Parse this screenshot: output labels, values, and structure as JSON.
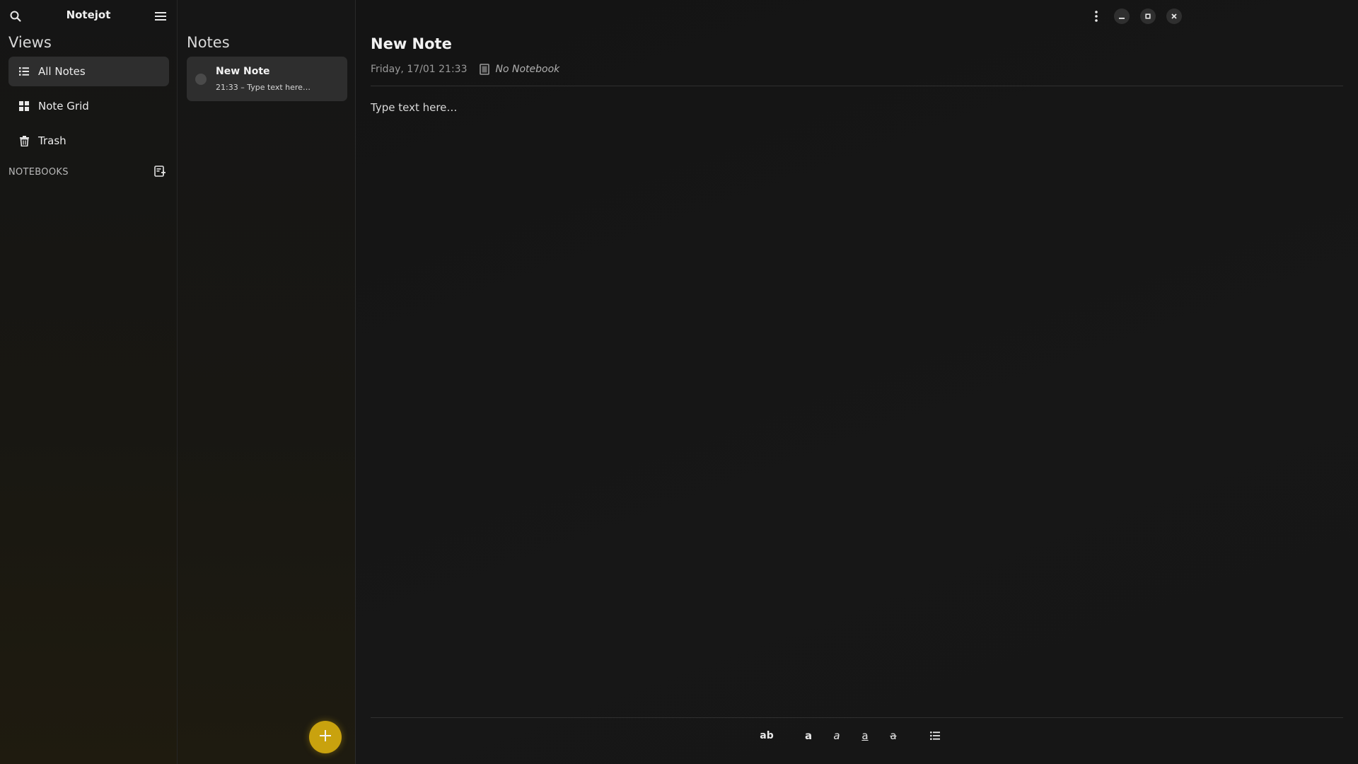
{
  "sidebar": {
    "title": "Notejot",
    "views_heading": "Views",
    "items": [
      {
        "label": "All Notes",
        "icon": "list-icon",
        "active": true
      },
      {
        "label": "Note Grid",
        "icon": "grid-icon",
        "active": false
      },
      {
        "label": "Trash",
        "icon": "trash-icon",
        "active": false
      }
    ],
    "notebooks_label": "NOTEBOOKS"
  },
  "notes_list": {
    "heading": "Notes",
    "notes": [
      {
        "title": "New Note",
        "subtitle": "21:33 – Type text here…"
      }
    ]
  },
  "editor": {
    "title": "New Note",
    "date": "Friday, 17/01 21:33",
    "notebook": "No Notebook",
    "body": "Type text here…",
    "format_buttons": [
      {
        "icon": "normal-text-icon",
        "glyph": "ab"
      },
      {
        "icon": "bold-icon",
        "glyph": "a"
      },
      {
        "icon": "italic-icon",
        "glyph": "a"
      },
      {
        "icon": "underline-icon",
        "glyph": "a"
      },
      {
        "icon": "strikethrough-icon",
        "glyph": "a"
      },
      {
        "icon": "bullet-list-icon",
        "glyph": ""
      }
    ]
  },
  "colors": {
    "accent": "#c9a20e",
    "active_item": "#2e2e2e",
    "background": "#141414"
  }
}
